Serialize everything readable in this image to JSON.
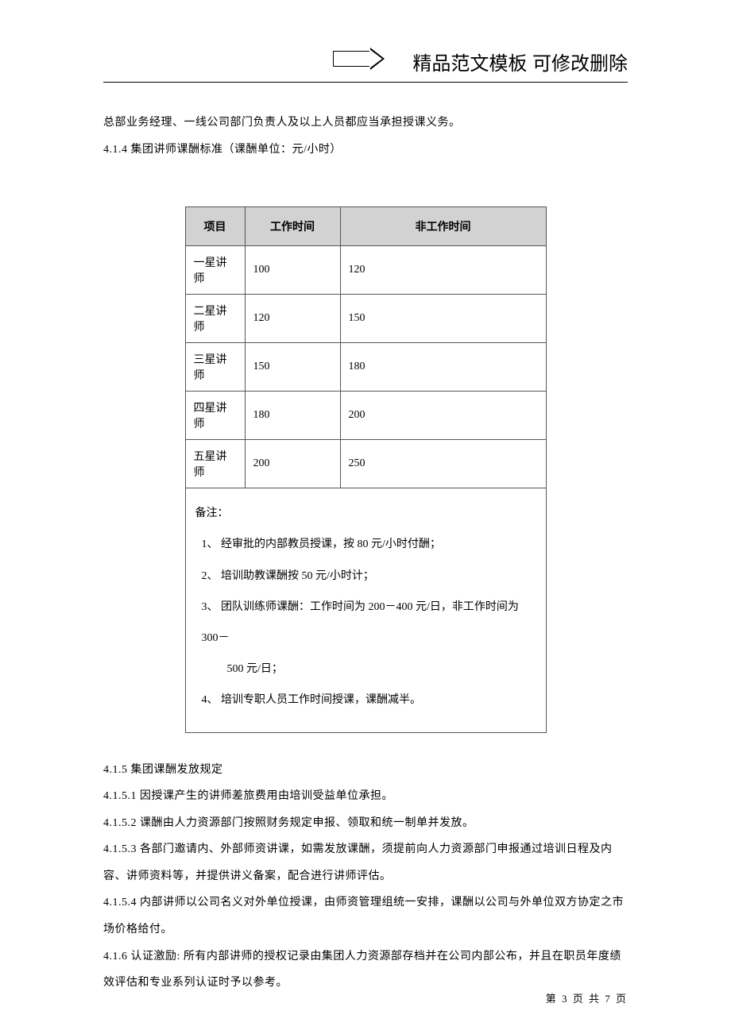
{
  "header": {
    "title": "精品范文模板  可修改删除"
  },
  "paragraphs": {
    "p1": "总部业务经理、一线公司部门负责人及以上人员都应当承担授课义务。",
    "p2": "4.1.4 集团讲师课酬标准（课酬单位：元/小时）",
    "p3": "4.1.5 集团课酬发放规定",
    "p4": "4.1.5.1 因授课产生的讲师差旅费用由培训受益单位承担。",
    "p5": "4.1.5.2 课酬由人力资源部门按照财务规定申报、领取和统一制单并发放。",
    "p6": "4.1.5.3 各部门邀请内、外部师资讲课，如需发放课酬，须提前向人力资源部门申报通过培训日程及内容、讲师资料等，并提供讲义备案，配合进行讲师评估。",
    "p7": "4.1.5.4 内部讲师以公司名义对外单位授课，由师资管理组统一安排，课酬以公司与外单位双方协定之市场价格给付。",
    "p8": "4.1.6  认证激励: 所有内部讲师的授权记录由集团人力资源部存档并在公司内部公布，并且在职员年度绩效评估和专业系列认证时予以参考。"
  },
  "table": {
    "headers": [
      "项目",
      "工作时间",
      "非工作时间"
    ],
    "rows": [
      [
        "一星讲师",
        "100",
        "120"
      ],
      [
        "二星讲师",
        "120",
        "150"
      ],
      [
        "三星讲师",
        "150",
        "180"
      ],
      [
        "四星讲师",
        "180",
        "200"
      ],
      [
        "五星讲师",
        "200",
        "250"
      ]
    ],
    "remark": {
      "title": "备注：",
      "items": [
        "1、  经审批的内部教员授课，按 80 元/小时付酬；",
        "2、  培训助教课酬按 50 元/小时计；",
        "3、  团队训练师课酬：工作时间为 200－400 元/日，非工作时间为 300－",
        "4、  培训专职人员工作时间授课，课酬减半。"
      ],
      "item3_sub": "500 元/日；"
    }
  },
  "footer": {
    "text": "第 3 页 共 7 页"
  }
}
